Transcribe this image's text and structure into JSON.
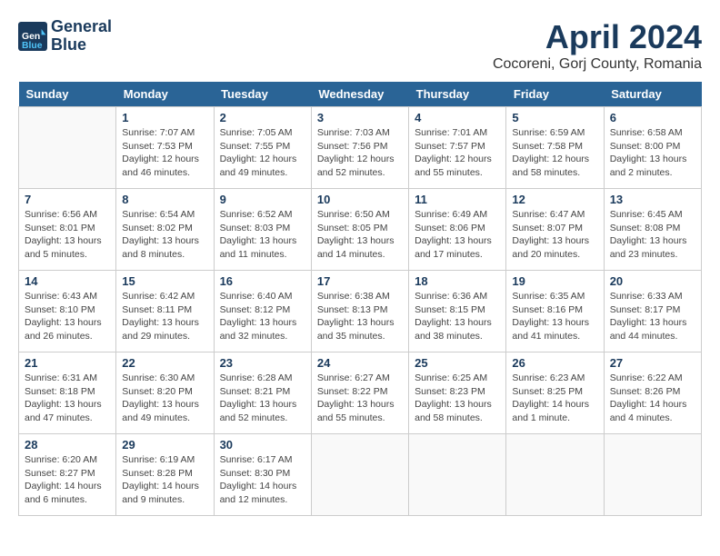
{
  "header": {
    "logo_line1": "General",
    "logo_line2": "Blue",
    "month": "April 2024",
    "location": "Cocoreni, Gorj County, Romania"
  },
  "weekdays": [
    "Sunday",
    "Monday",
    "Tuesday",
    "Wednesday",
    "Thursday",
    "Friday",
    "Saturday"
  ],
  "weeks": [
    [
      {
        "day": "",
        "sunrise": "",
        "sunset": "",
        "daylight": ""
      },
      {
        "day": "1",
        "sunrise": "Sunrise: 7:07 AM",
        "sunset": "Sunset: 7:53 PM",
        "daylight": "Daylight: 12 hours and 46 minutes."
      },
      {
        "day": "2",
        "sunrise": "Sunrise: 7:05 AM",
        "sunset": "Sunset: 7:55 PM",
        "daylight": "Daylight: 12 hours and 49 minutes."
      },
      {
        "day": "3",
        "sunrise": "Sunrise: 7:03 AM",
        "sunset": "Sunset: 7:56 PM",
        "daylight": "Daylight: 12 hours and 52 minutes."
      },
      {
        "day": "4",
        "sunrise": "Sunrise: 7:01 AM",
        "sunset": "Sunset: 7:57 PM",
        "daylight": "Daylight: 12 hours and 55 minutes."
      },
      {
        "day": "5",
        "sunrise": "Sunrise: 6:59 AM",
        "sunset": "Sunset: 7:58 PM",
        "daylight": "Daylight: 12 hours and 58 minutes."
      },
      {
        "day": "6",
        "sunrise": "Sunrise: 6:58 AM",
        "sunset": "Sunset: 8:00 PM",
        "daylight": "Daylight: 13 hours and 2 minutes."
      }
    ],
    [
      {
        "day": "7",
        "sunrise": "Sunrise: 6:56 AM",
        "sunset": "Sunset: 8:01 PM",
        "daylight": "Daylight: 13 hours and 5 minutes."
      },
      {
        "day": "8",
        "sunrise": "Sunrise: 6:54 AM",
        "sunset": "Sunset: 8:02 PM",
        "daylight": "Daylight: 13 hours and 8 minutes."
      },
      {
        "day": "9",
        "sunrise": "Sunrise: 6:52 AM",
        "sunset": "Sunset: 8:03 PM",
        "daylight": "Daylight: 13 hours and 11 minutes."
      },
      {
        "day": "10",
        "sunrise": "Sunrise: 6:50 AM",
        "sunset": "Sunset: 8:05 PM",
        "daylight": "Daylight: 13 hours and 14 minutes."
      },
      {
        "day": "11",
        "sunrise": "Sunrise: 6:49 AM",
        "sunset": "Sunset: 8:06 PM",
        "daylight": "Daylight: 13 hours and 17 minutes."
      },
      {
        "day": "12",
        "sunrise": "Sunrise: 6:47 AM",
        "sunset": "Sunset: 8:07 PM",
        "daylight": "Daylight: 13 hours and 20 minutes."
      },
      {
        "day": "13",
        "sunrise": "Sunrise: 6:45 AM",
        "sunset": "Sunset: 8:08 PM",
        "daylight": "Daylight: 13 hours and 23 minutes."
      }
    ],
    [
      {
        "day": "14",
        "sunrise": "Sunrise: 6:43 AM",
        "sunset": "Sunset: 8:10 PM",
        "daylight": "Daylight: 13 hours and 26 minutes."
      },
      {
        "day": "15",
        "sunrise": "Sunrise: 6:42 AM",
        "sunset": "Sunset: 8:11 PM",
        "daylight": "Daylight: 13 hours and 29 minutes."
      },
      {
        "day": "16",
        "sunrise": "Sunrise: 6:40 AM",
        "sunset": "Sunset: 8:12 PM",
        "daylight": "Daylight: 13 hours and 32 minutes."
      },
      {
        "day": "17",
        "sunrise": "Sunrise: 6:38 AM",
        "sunset": "Sunset: 8:13 PM",
        "daylight": "Daylight: 13 hours and 35 minutes."
      },
      {
        "day": "18",
        "sunrise": "Sunrise: 6:36 AM",
        "sunset": "Sunset: 8:15 PM",
        "daylight": "Daylight: 13 hours and 38 minutes."
      },
      {
        "day": "19",
        "sunrise": "Sunrise: 6:35 AM",
        "sunset": "Sunset: 8:16 PM",
        "daylight": "Daylight: 13 hours and 41 minutes."
      },
      {
        "day": "20",
        "sunrise": "Sunrise: 6:33 AM",
        "sunset": "Sunset: 8:17 PM",
        "daylight": "Daylight: 13 hours and 44 minutes."
      }
    ],
    [
      {
        "day": "21",
        "sunrise": "Sunrise: 6:31 AM",
        "sunset": "Sunset: 8:18 PM",
        "daylight": "Daylight: 13 hours and 47 minutes."
      },
      {
        "day": "22",
        "sunrise": "Sunrise: 6:30 AM",
        "sunset": "Sunset: 8:20 PM",
        "daylight": "Daylight: 13 hours and 49 minutes."
      },
      {
        "day": "23",
        "sunrise": "Sunrise: 6:28 AM",
        "sunset": "Sunset: 8:21 PM",
        "daylight": "Daylight: 13 hours and 52 minutes."
      },
      {
        "day": "24",
        "sunrise": "Sunrise: 6:27 AM",
        "sunset": "Sunset: 8:22 PM",
        "daylight": "Daylight: 13 hours and 55 minutes."
      },
      {
        "day": "25",
        "sunrise": "Sunrise: 6:25 AM",
        "sunset": "Sunset: 8:23 PM",
        "daylight": "Daylight: 13 hours and 58 minutes."
      },
      {
        "day": "26",
        "sunrise": "Sunrise: 6:23 AM",
        "sunset": "Sunset: 8:25 PM",
        "daylight": "Daylight: 14 hours and 1 minute."
      },
      {
        "day": "27",
        "sunrise": "Sunrise: 6:22 AM",
        "sunset": "Sunset: 8:26 PM",
        "daylight": "Daylight: 14 hours and 4 minutes."
      }
    ],
    [
      {
        "day": "28",
        "sunrise": "Sunrise: 6:20 AM",
        "sunset": "Sunset: 8:27 PM",
        "daylight": "Daylight: 14 hours and 6 minutes."
      },
      {
        "day": "29",
        "sunrise": "Sunrise: 6:19 AM",
        "sunset": "Sunset: 8:28 PM",
        "daylight": "Daylight: 14 hours and 9 minutes."
      },
      {
        "day": "30",
        "sunrise": "Sunrise: 6:17 AM",
        "sunset": "Sunset: 8:30 PM",
        "daylight": "Daylight: 14 hours and 12 minutes."
      },
      {
        "day": "",
        "sunrise": "",
        "sunset": "",
        "daylight": ""
      },
      {
        "day": "",
        "sunrise": "",
        "sunset": "",
        "daylight": ""
      },
      {
        "day": "",
        "sunrise": "",
        "sunset": "",
        "daylight": ""
      },
      {
        "day": "",
        "sunrise": "",
        "sunset": "",
        "daylight": ""
      }
    ]
  ]
}
